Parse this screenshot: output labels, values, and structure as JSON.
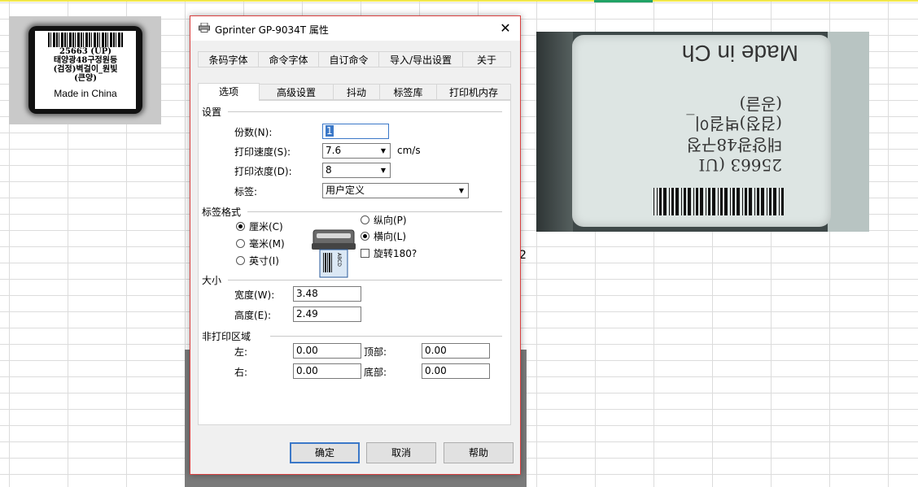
{
  "spreadsheet": {
    "cell_fragment": "2"
  },
  "left_label": {
    "line1": "25663  (UP)",
    "line2": "태양광48구정원등",
    "line3": "(검정)벽걸이_원빛",
    "line4": "(큰양)",
    "made_in": "Made in China"
  },
  "photo": {
    "made_in": "Made in Ch",
    "line1": "(공글)",
    "line2": "(검정)벽걸이_",
    "line3": "태양광48구정",
    "line4": "25663  (UI"
  },
  "dialog": {
    "title": "Gprinter  GP-9034T 属性",
    "close_symbol": "✕",
    "tabs_row1": [
      "条码字体",
      "命令字体",
      "自订命令",
      "导入/导出设置",
      "关于"
    ],
    "tabs_row2": [
      "选项",
      "高级设置",
      "抖动",
      "标签库",
      "打印机内存"
    ],
    "active_tab": "选项",
    "settings": {
      "group_title": "设置",
      "copies_label": "份数(N):",
      "copies_value": "1",
      "speed_label": "打印速度(S):",
      "speed_value": "7.6",
      "speed_unit": "cm/s",
      "density_label": "打印浓度(D):",
      "density_value": "8",
      "label_label": "标签:",
      "label_value": "用户定义"
    },
    "format": {
      "group_title": "标签格式",
      "unit_options": [
        {
          "label": "厘米(C)",
          "selected": true
        },
        {
          "label": "毫米(M)",
          "selected": false
        },
        {
          "label": "英寸(I)",
          "selected": false
        }
      ],
      "orientation_options": [
        {
          "label": "纵向(P)",
          "selected": false
        },
        {
          "label": "横向(L)",
          "selected": true
        }
      ],
      "rotate_label": "旋转180?",
      "rotate_checked": false,
      "icon_text": "ABCD"
    },
    "size": {
      "group_title": "大小",
      "width_label": "宽度(W):",
      "width_value": "3.48",
      "height_label": "高度(E):",
      "height_value": "2.49"
    },
    "margins": {
      "group_title": "非打印区域",
      "left_label": "左:",
      "left_value": "0.00",
      "top_label": "顶部:",
      "top_value": "0.00",
      "right_label": "右:",
      "right_value": "0.00",
      "bottom_label": "底部:",
      "bottom_value": "0.00"
    },
    "buttons": {
      "ok": "确定",
      "cancel": "取消",
      "help": "帮助"
    }
  }
}
